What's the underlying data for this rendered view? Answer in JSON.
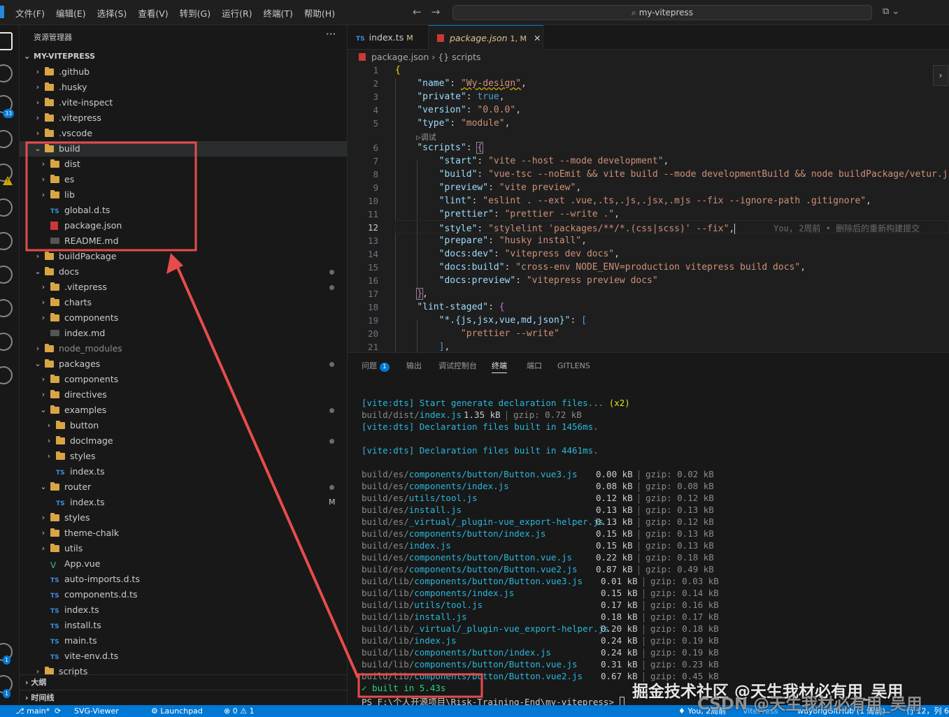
{
  "menu": [
    "文件(F)",
    "编辑(E)",
    "选择(S)",
    "查看(V)",
    "转到(G)",
    "运行(R)",
    "终端(T)",
    "帮助(H)"
  ],
  "nav": {
    "back": "←",
    "forward": "→"
  },
  "command_center": {
    "icon": "⌕",
    "text": "my-vitepress"
  },
  "layout_control": "⧉ ⌄",
  "activity": {
    "scm_badge": "33",
    "warn_badge": "!",
    "accounts_badge": "1",
    "manage_badge": "1"
  },
  "explorer": {
    "title": "资源管理器",
    "more": "···",
    "root": "MY-VITEPRESS",
    "chev_open": "⌄",
    "chev_closed": "›",
    "items": [
      {
        "label": ".github",
        "depth": 0,
        "kind": "folder",
        "open": false
      },
      {
        "label": ".husky",
        "depth": 0,
        "kind": "folder",
        "open": false
      },
      {
        "label": ".vite-inspect",
        "depth": 0,
        "kind": "folder",
        "open": false
      },
      {
        "label": ".vitepress",
        "depth": 0,
        "kind": "folder",
        "open": false
      },
      {
        "label": ".vscode",
        "depth": 0,
        "kind": "folder",
        "open": false
      },
      {
        "label": "build",
        "depth": 0,
        "kind": "folder",
        "open": true,
        "selected": true
      },
      {
        "label": "dist",
        "depth": 1,
        "kind": "folder",
        "open": false
      },
      {
        "label": "es",
        "depth": 1,
        "kind": "folder",
        "open": false
      },
      {
        "label": "lib",
        "depth": 1,
        "kind": "folder",
        "open": false
      },
      {
        "label": "global.d.ts",
        "depth": 1,
        "kind": "ts"
      },
      {
        "label": "package.json",
        "depth": 1,
        "kind": "json"
      },
      {
        "label": "README.md",
        "depth": 1,
        "kind": "md"
      },
      {
        "label": "buildPackage",
        "depth": 0,
        "kind": "folder",
        "open": false
      },
      {
        "label": "docs",
        "depth": 0,
        "kind": "folder",
        "open": true,
        "dot": true
      },
      {
        "label": ".vitepress",
        "depth": 1,
        "kind": "folder",
        "open": false,
        "dot": true
      },
      {
        "label": "charts",
        "depth": 1,
        "kind": "folder",
        "open": false
      },
      {
        "label": "components",
        "depth": 1,
        "kind": "folder",
        "open": false
      },
      {
        "label": "index.md",
        "depth": 1,
        "kind": "md"
      },
      {
        "label": "node_modules",
        "depth": 0,
        "kind": "folder",
        "open": false,
        "dim": true
      },
      {
        "label": "packages",
        "depth": 0,
        "kind": "folder",
        "open": true,
        "dot": true
      },
      {
        "label": "components",
        "depth": 1,
        "kind": "folder",
        "open": false
      },
      {
        "label": "directives",
        "depth": 1,
        "kind": "folder",
        "open": false
      },
      {
        "label": "examples",
        "depth": 1,
        "kind": "folder",
        "open": true,
        "dot": true
      },
      {
        "label": "button",
        "depth": 2,
        "kind": "folder",
        "open": false
      },
      {
        "label": "docImage",
        "depth": 2,
        "kind": "folder",
        "open": false,
        "dot": true
      },
      {
        "label": "styles",
        "depth": 2,
        "kind": "folder",
        "open": false
      },
      {
        "label": "index.ts",
        "depth": 2,
        "kind": "ts"
      },
      {
        "label": "router",
        "depth": 1,
        "kind": "folder",
        "open": true,
        "dot": true
      },
      {
        "label": "index.ts",
        "depth": 2,
        "kind": "ts",
        "mark": "M"
      },
      {
        "label": "styles",
        "depth": 1,
        "kind": "folder",
        "open": false
      },
      {
        "label": "theme-chalk",
        "depth": 1,
        "kind": "folder",
        "open": false
      },
      {
        "label": "utils",
        "depth": 1,
        "kind": "folder",
        "open": false
      },
      {
        "label": "App.vue",
        "depth": 1,
        "kind": "vue"
      },
      {
        "label": "auto-imports.d.ts",
        "depth": 1,
        "kind": "ts"
      },
      {
        "label": "components.d.ts",
        "depth": 1,
        "kind": "ts"
      },
      {
        "label": "index.ts",
        "depth": 1,
        "kind": "ts"
      },
      {
        "label": "install.ts",
        "depth": 1,
        "kind": "ts"
      },
      {
        "label": "main.ts",
        "depth": 1,
        "kind": "ts"
      },
      {
        "label": "vite-env.d.ts",
        "depth": 1,
        "kind": "ts"
      },
      {
        "label": "scripts",
        "depth": 0,
        "kind": "folder",
        "open": false
      }
    ],
    "ts_icon": "TS",
    "vue_icon": "V",
    "outline": "大纲",
    "timeline": "时间线"
  },
  "tabs": [
    {
      "icon": "TS",
      "label": "index.ts",
      "status": "M",
      "active": false
    },
    {
      "label": "package.json",
      "status": "1, M",
      "active": true,
      "close": "✕"
    }
  ],
  "breadcrumb": {
    "file": "package.json",
    "sep": "›",
    "symbol": "{} scripts"
  },
  "editor": {
    "current_line": 12,
    "debug_lens": "▷调试",
    "blame": "You, 2周前 • 删除后的重新构建提交",
    "expand": "›"
  },
  "panel": {
    "tabs": [
      {
        "label": "问题",
        "badge": "1"
      },
      {
        "label": "输出"
      },
      {
        "label": "调试控制台"
      },
      {
        "label": "终端",
        "active": true
      },
      {
        "label": "端口"
      },
      {
        "label": "GITLENS"
      }
    ],
    "msg1": "[vite:dts] Start generate declaration files...",
    "msg1_count": "(x2)",
    "dist_file": "build/dist/",
    "dist_name": "index.js",
    "dist_size": "1.35 kB",
    "dist_gzip": "gzip: 0.72 kB",
    "msg2": "[vite:dts] Declaration files built in 1456ms.",
    "msg3": "[vite:dts] Declaration files built in 4461ms.",
    "built": "✓ built in 5.43s",
    "prompt": "PS F:\\个人开源项目\\Risk-Training-End\\my-vitepress> "
  },
  "terminal_rows": [
    {
      "dir": "build/es/",
      "name": "components/button/Button.vue3.js",
      "size": "0.00 kB",
      "gzip": "gzip: 0.02 kB"
    },
    {
      "dir": "build/es/",
      "name": "components/index.js",
      "size": "0.08 kB",
      "gzip": "gzip: 0.08 kB"
    },
    {
      "dir": "build/es/",
      "name": "utils/tool.js",
      "size": "0.12 kB",
      "gzip": "gzip: 0.12 kB"
    },
    {
      "dir": "build/es/",
      "name": "install.js",
      "size": "0.13 kB",
      "gzip": "gzip: 0.13 kB"
    },
    {
      "dir": "build/es/",
      "name": "_virtual/_plugin-vue_export-helper.js",
      "size": "0.13 kB",
      "gzip": "gzip: 0.12 kB"
    },
    {
      "dir": "build/es/",
      "name": "components/button/index.js",
      "size": "0.15 kB",
      "gzip": "gzip: 0.13 kB"
    },
    {
      "dir": "build/es/",
      "name": "index.js",
      "size": "0.15 kB",
      "gzip": "gzip: 0.13 kB"
    },
    {
      "dir": "build/es/",
      "name": "components/button/Button.vue.js",
      "size": "0.22 kB",
      "gzip": "gzip: 0.18 kB"
    },
    {
      "dir": "build/es/",
      "name": "components/button/Button.vue2.js",
      "size": "0.87 kB",
      "gzip": "gzip: 0.49 kB"
    },
    {
      "dir": "build/lib/",
      "name": "components/button/Button.vue3.js",
      "size": "0.01 kB",
      "gzip": "gzip: 0.03 kB"
    },
    {
      "dir": "build/lib/",
      "name": "components/index.js",
      "size": "0.15 kB",
      "gzip": "gzip: 0.14 kB"
    },
    {
      "dir": "build/lib/",
      "name": "utils/tool.js",
      "size": "0.17 kB",
      "gzip": "gzip: 0.16 kB"
    },
    {
      "dir": "build/lib/",
      "name": "install.js",
      "size": "0.18 kB",
      "gzip": "gzip: 0.17 kB"
    },
    {
      "dir": "build/lib/",
      "name": "_virtual/_plugin-vue_export-helper.js",
      "size": "0.20 kB",
      "gzip": "gzip: 0.18 kB"
    },
    {
      "dir": "build/lib/",
      "name": "index.js",
      "size": "0.24 kB",
      "gzip": "gzip: 0.19 kB"
    },
    {
      "dir": "build/lib/",
      "name": "components/button/index.js",
      "size": "0.24 kB",
      "gzip": "gzip: 0.19 kB"
    },
    {
      "dir": "build/lib/",
      "name": "components/button/Button.vue.js",
      "size": "0.31 kB",
      "gzip": "gzip: 0.23 kB"
    },
    {
      "dir": "build/lib/",
      "name": "components/button/Button.vue2.js",
      "size": "0.67 kB",
      "gzip": "gzip: 0.45 kB"
    }
  ],
  "statusbar": {
    "branch": "⎇ main*",
    "sync": "⟳",
    "svg_viewer": "SVG-Viewer",
    "launchpad": "⚙ Launchpad",
    "problems": "⊗ 0 ⚠ 1",
    "blame": "♦ You, 2周前",
    "vitepress": "VitePress",
    "account": "wuyongGitHub (1 周前)",
    "position": "行 12，列 6"
  },
  "watermark": {
    "line1": "掘金技术社区 @天生我材必有用_吴用",
    "line2": "CSDN @天生我材必有用_吴用"
  },
  "colors": {
    "annotation": "#e74c4c",
    "accent": "#0078d4",
    "folder": "#d8a545"
  }
}
